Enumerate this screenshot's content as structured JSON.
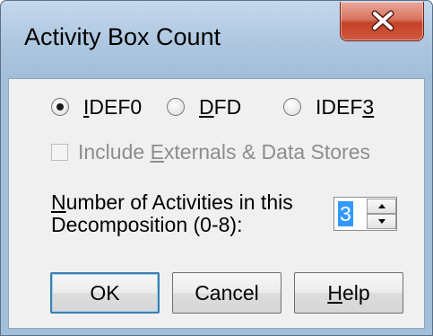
{
  "window": {
    "title": "Activity Box Count"
  },
  "methodology": {
    "options": [
      {
        "pre": "",
        "mnemonic": "I",
        "post": "DEF0",
        "selected": true
      },
      {
        "pre": "",
        "mnemonic": "D",
        "post": "FD",
        "selected": false
      },
      {
        "pre": "IDEF",
        "mnemonic": "3",
        "post": "",
        "selected": false
      }
    ]
  },
  "externals_checkbox": {
    "pre": "Include ",
    "mnemonic": "E",
    "post": "xternals & Data Stores",
    "checked": false,
    "enabled": false
  },
  "activities": {
    "label_line1_mnemonic": "N",
    "label_line1_rest": "umber of Activities in this",
    "label_line2": "Decomposition (0-8):",
    "value": "3"
  },
  "buttons": {
    "ok": "OK",
    "cancel": "Cancel",
    "help_mnemonic": "H",
    "help_rest": "elp"
  },
  "colors": {
    "frame": "#a3bed9",
    "client": "#f0f0f0",
    "close_button": "#c44128",
    "selection": "#3399ff",
    "default_button_border": "#3c7fb1",
    "disabled_text": "#8d8d8d"
  },
  "icons": {
    "close": "close-icon",
    "spin_up": "spin-up-arrow-icon",
    "spin_down": "spin-down-arrow-icon"
  }
}
